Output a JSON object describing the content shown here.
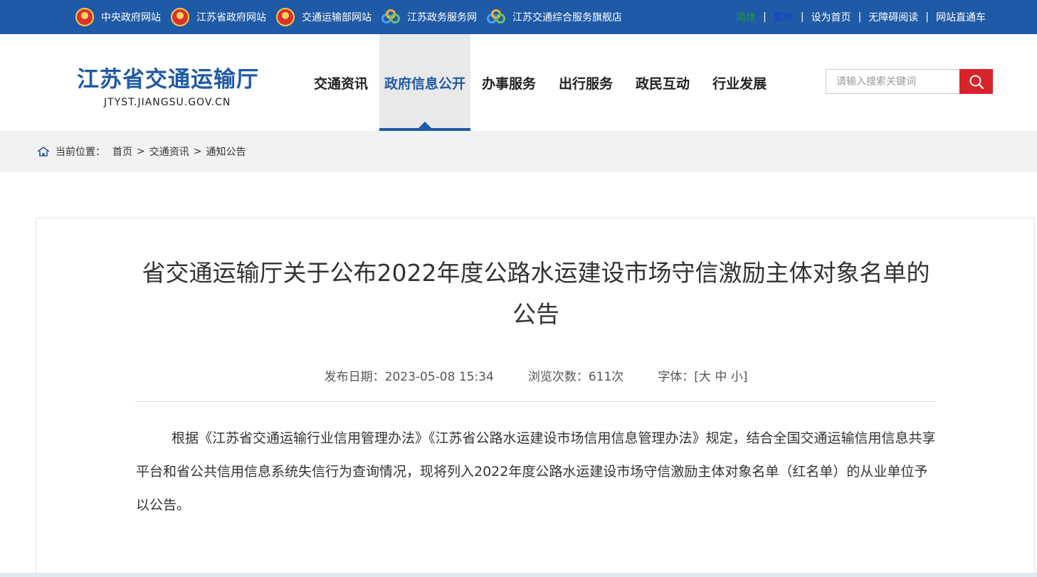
{
  "topbar": {
    "links": [
      {
        "label": "中央政府网站",
        "icon": "national-emblem-icon"
      },
      {
        "label": "江苏省政府网站",
        "icon": "national-emblem-icon"
      },
      {
        "label": "交通运输部网站",
        "icon": "national-emblem-icon"
      },
      {
        "label": "江苏政务服务网",
        "icon": "gov-service-logo-icon"
      },
      {
        "label": "江苏交通综合服务旗舰店",
        "icon": "gov-service-logo-icon"
      }
    ],
    "right": {
      "simplified": "简体",
      "traditional": "繁体",
      "set_home": "设为首页",
      "accessible": "无障碍阅读",
      "directory": "网站直通车"
    }
  },
  "header": {
    "logo_cn": "江苏省交通运输厅",
    "logo_en": "JTYST.JIANGSU.GOV.CN",
    "nav": [
      "交通资讯",
      "政府信息公开",
      "办事服务",
      "出行服务",
      "政民互动",
      "行业发展"
    ],
    "active_nav": "政府信息公开",
    "search_placeholder": "请输入搜索关键词"
  },
  "breadcrumb": {
    "label": "当前位置：",
    "items": [
      "首页",
      "交通资讯",
      "通知公告"
    ],
    "separator": ">"
  },
  "article": {
    "title": "省交通运输厅关于公布2022年度公路水运建设市场守信激励主体对象名单的公告",
    "publish_label": "发布日期：",
    "publish_date": "2023-05-08 15:34",
    "views_label": "浏览次数：",
    "views": "611次",
    "font_label": "字体：",
    "font_open": "[",
    "font_large": "大",
    "font_medium": "中",
    "font_small": "小",
    "font_close": "]",
    "body": "根据《江苏省交通运输行业信用管理办法》《江苏省公路水运建设市场信用信息管理办法》规定，结合全国交通运输信用信息共享平台和省公共信用信息系统失信行为查询情况，现将列入2022年度公路水运建设市场守信激励主体对象名单（红名单）的从业单位予以公告。"
  },
  "colors": {
    "brand_blue": "#1f5aa6",
    "search_red": "#d8232a"
  }
}
